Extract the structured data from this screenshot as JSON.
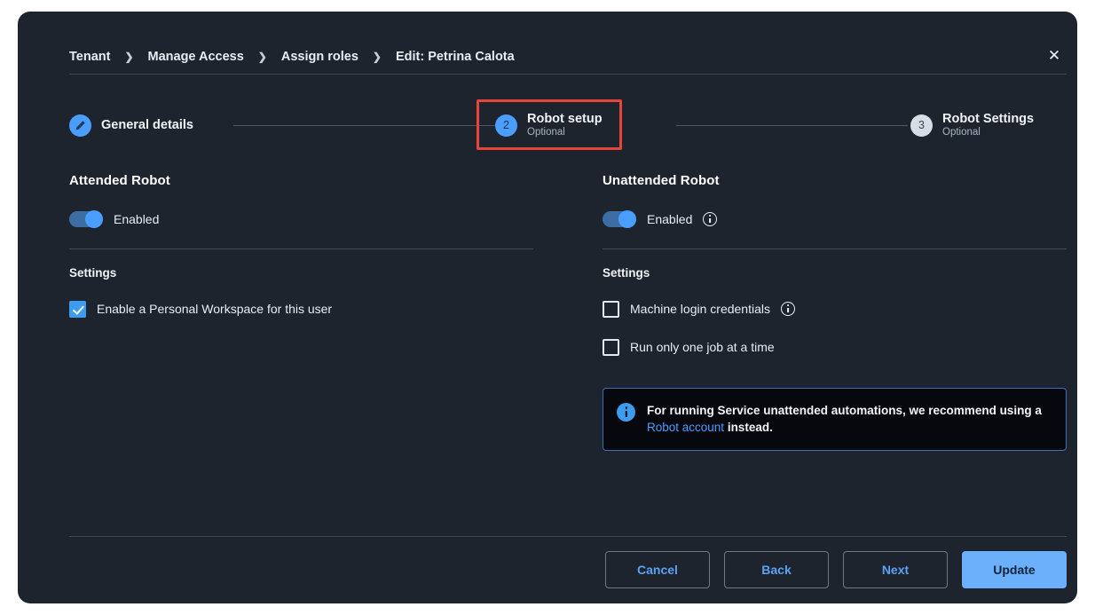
{
  "breadcrumb": {
    "separator": "❯",
    "items": [
      "Tenant",
      "Manage Access",
      "Assign roles",
      "Edit: Petrina Calota"
    ]
  },
  "close_icon": "✕",
  "stepper": {
    "steps": [
      {
        "number": "",
        "title": "General details",
        "subtitle": "",
        "state": "completed",
        "icon": "pencil-icon"
      },
      {
        "number": "2",
        "title": "Robot setup",
        "subtitle": "Optional",
        "state": "active",
        "icon": ""
      },
      {
        "number": "3",
        "title": "Robot Settings",
        "subtitle": "Optional",
        "state": "idle",
        "icon": ""
      }
    ],
    "highlight_color": "#e8443a"
  },
  "attended": {
    "title": "Attended Robot",
    "toggle_label": "Enabled",
    "toggle_on": true,
    "settings_title": "Settings",
    "options": [
      {
        "label": "Enable a Personal Workspace for this user",
        "checked": true
      }
    ]
  },
  "unattended": {
    "title": "Unattended Robot",
    "toggle_label": "Enabled",
    "toggle_on": true,
    "toggle_info_icon": "info-icon",
    "settings_title": "Settings",
    "options": [
      {
        "label": "Machine login credentials",
        "checked": false,
        "info_icon": "info-icon"
      },
      {
        "label": "Run only one job at a time",
        "checked": false
      }
    ],
    "banner": {
      "icon": "info-icon",
      "text_before": "For running Service unattended automations, we recommend using a ",
      "link": "Robot account",
      "text_after": " instead.",
      "border_color": "#3f6fb5"
    }
  },
  "footer": {
    "cancel": "Cancel",
    "back": "Back",
    "next": "Next",
    "update": "Update",
    "primary_color": "#6cb0fb"
  }
}
